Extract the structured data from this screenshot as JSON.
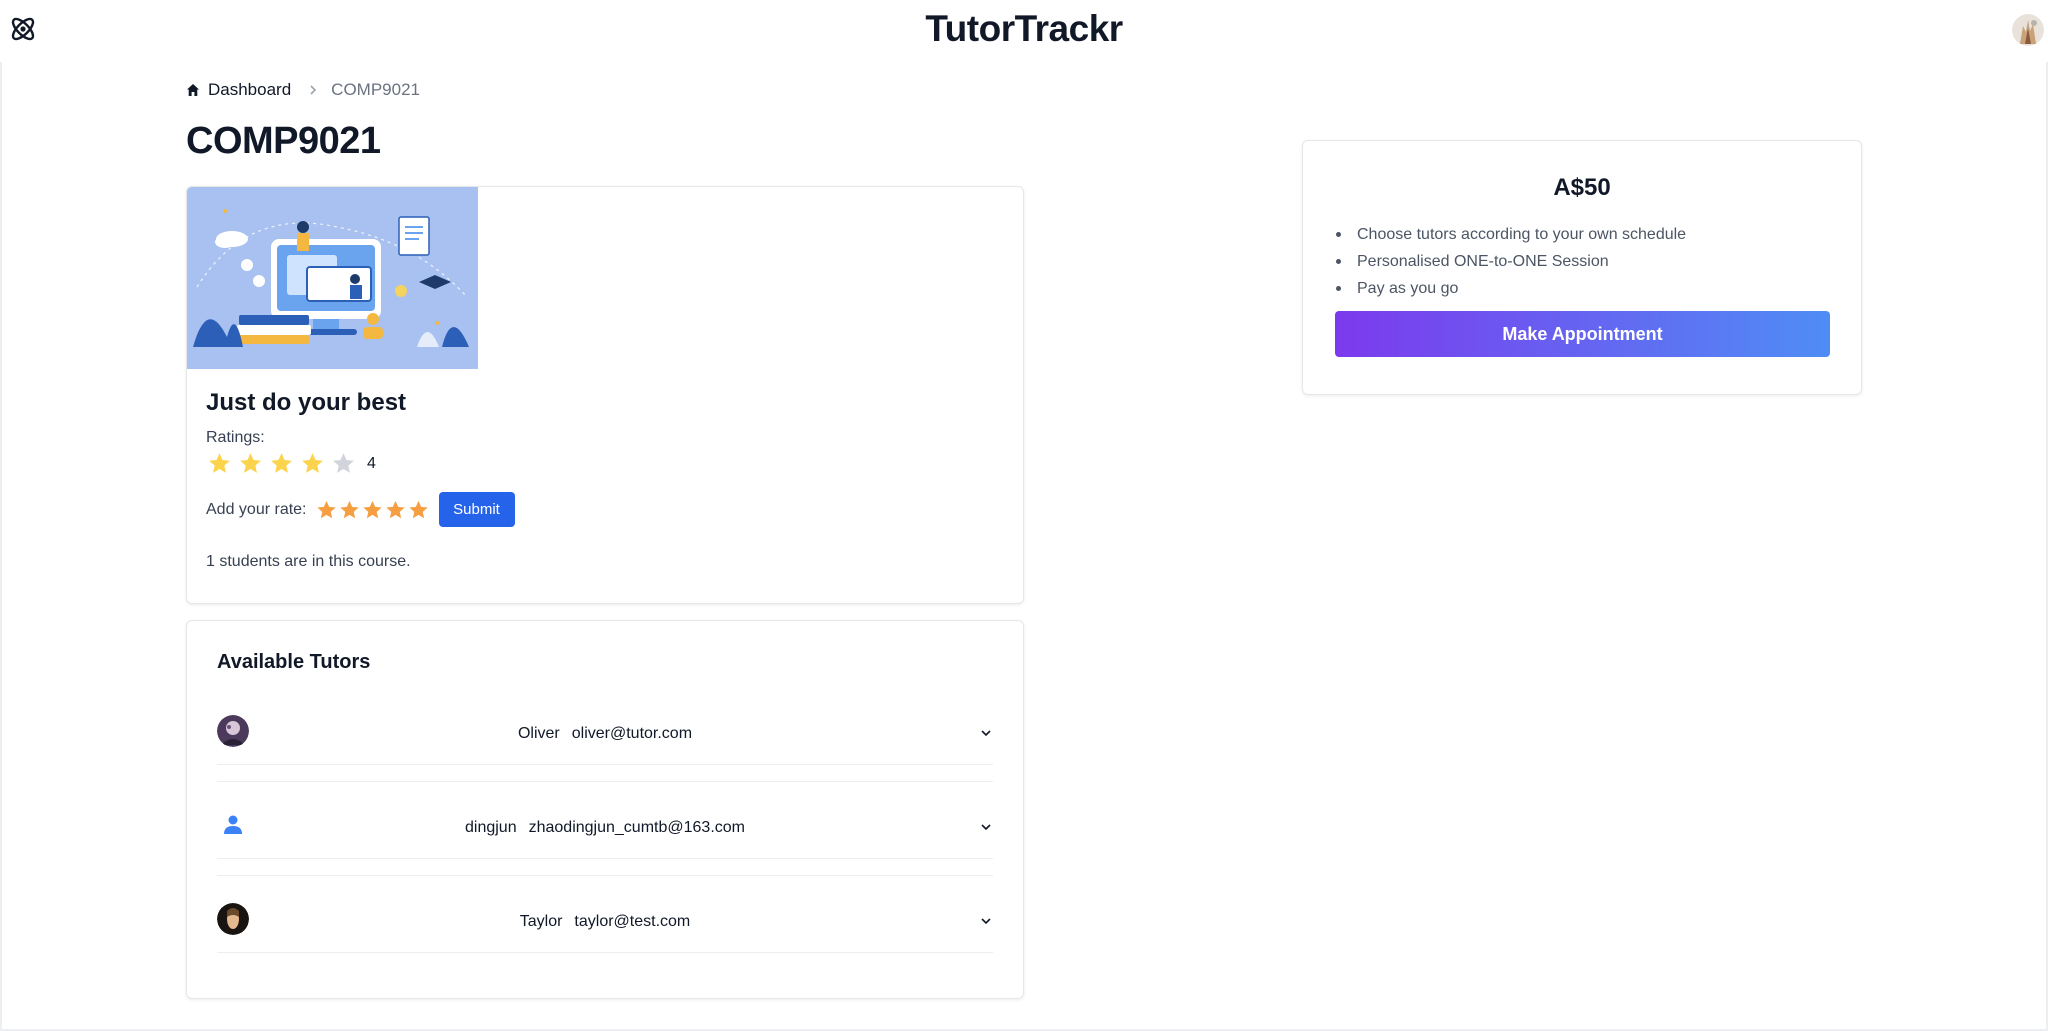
{
  "app": {
    "title": "TutorTrackr"
  },
  "breadcrumb": {
    "home_label": "Dashboard",
    "current": "COMP9021"
  },
  "course": {
    "code": "COMP9021",
    "heading": "Just do your best",
    "ratings_label": "Ratings:",
    "rating_value": 4,
    "rating_display": "4",
    "rating_max": 5,
    "add_rate_label": "Add your rate:",
    "user_rate_stars": 5,
    "submit_label": "Submit",
    "students_text": "1 students are in this course."
  },
  "tutors": {
    "heading": "Available Tutors",
    "items": [
      {
        "name": "Oliver",
        "email": "oliver@tutor.com",
        "avatar": "photo"
      },
      {
        "name": "dingjun",
        "email": "zhaodingjun_cumtb@163.com",
        "avatar": "person-icon"
      },
      {
        "name": "Taylor",
        "email": "taylor@test.com",
        "avatar": "photo"
      }
    ]
  },
  "pricing": {
    "price": "A$50",
    "features": [
      "Choose tutors according to your own schedule",
      "Personalised ONE-to-ONE Session",
      "Pay as you go"
    ],
    "button_label": "Make Appointment"
  },
  "colors": {
    "accent_blue": "#2563eb",
    "star_filled": "#fcd34d",
    "star_empty": "#d1d5db",
    "rate_star": "#f59e42",
    "gradient_start": "#7c3aed",
    "gradient_end": "#4f8df5"
  }
}
